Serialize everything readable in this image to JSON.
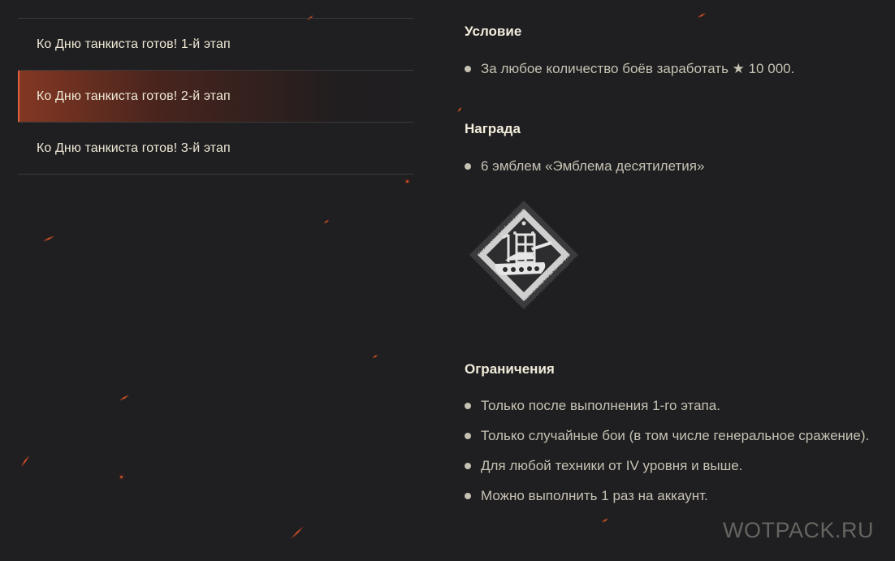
{
  "stages": [
    {
      "label": "Ко Дню танкиста готов! 1-й этап",
      "active": false
    },
    {
      "label": "Ко Дню танкиста готов! 2-й этап",
      "active": true
    },
    {
      "label": "Ко Дню танкиста готов! 3-й этап",
      "active": false
    }
  ],
  "condition": {
    "title": "Условие",
    "items": [
      "За любое количество боёв заработать ★ 10 000."
    ]
  },
  "reward": {
    "title": "Награда",
    "items": [
      "6 эмблем «Эмблема десятилетия»"
    ],
    "emblem_icon": "tenth-anniversary-emblem-icon"
  },
  "restrictions": {
    "title": "Ограничения",
    "items": [
      "Только после выполнения 1-го этапа.",
      "Только случайные бои (в том числе генеральное сражение).",
      "Для любой техники от IV уровня и выше.",
      "Можно выполнить 1 раз на аккаунт."
    ]
  },
  "watermark": "WOTPACK.RU",
  "colors": {
    "background": "#1f1e20",
    "active_accent": "#e2603a",
    "text": "#c6c2b4",
    "heading": "#f1ecdc"
  }
}
